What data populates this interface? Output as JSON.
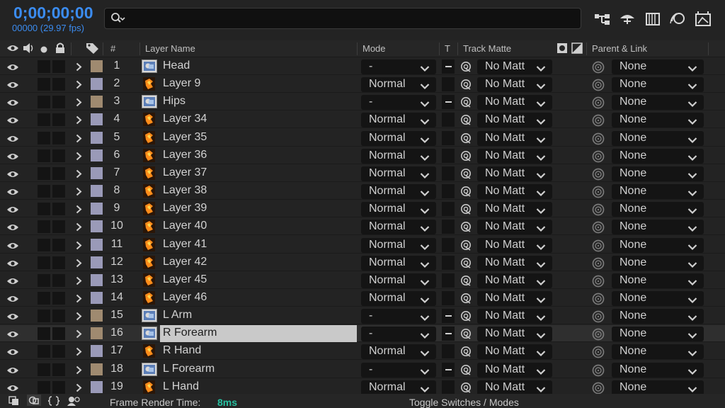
{
  "timecode": {
    "main": "0;00;00;00",
    "sub": "00000 (29.97 fps)"
  },
  "search": {
    "placeholder": ""
  },
  "toolbar_icons": [
    "comp-flowchart-icon",
    "draft-3d-icon",
    "frame-blending-icon",
    "motion-blur-icon",
    "graph-editor-icon"
  ],
  "columns": {
    "number": "#",
    "layer_name": "Layer Name",
    "mode": "Mode",
    "t": "T",
    "track_matte": "Track Matte",
    "parent": "Parent & Link"
  },
  "label_colors": {
    "tan": "#9f8a70",
    "lavender": "#9a9ab8"
  },
  "layers": [
    {
      "num": "1",
      "name": "Head",
      "type": "precomp",
      "label": "tan",
      "mode": "-",
      "t": true,
      "matte": "No Matt",
      "parent": "None"
    },
    {
      "num": "2",
      "name": "Layer 9",
      "type": "ai",
      "label": "lavender",
      "mode": "Normal",
      "t": false,
      "matte": "No Matt",
      "parent": "None"
    },
    {
      "num": "3",
      "name": "Hips",
      "type": "precomp",
      "label": "tan",
      "mode": "-",
      "t": true,
      "matte": "No Matt",
      "parent": "None"
    },
    {
      "num": "4",
      "name": "Layer 34",
      "type": "ai",
      "label": "lavender",
      "mode": "Normal",
      "t": false,
      "matte": "No Matt",
      "parent": "None"
    },
    {
      "num": "5",
      "name": "Layer 35",
      "type": "ai",
      "label": "lavender",
      "mode": "Normal",
      "t": false,
      "matte": "No Matt",
      "parent": "None"
    },
    {
      "num": "6",
      "name": "Layer 36",
      "type": "ai",
      "label": "lavender",
      "mode": "Normal",
      "t": false,
      "matte": "No Matt",
      "parent": "None"
    },
    {
      "num": "7",
      "name": "Layer 37",
      "type": "ai",
      "label": "lavender",
      "mode": "Normal",
      "t": false,
      "matte": "No Matt",
      "parent": "None"
    },
    {
      "num": "8",
      "name": "Layer 38",
      "type": "ai",
      "label": "lavender",
      "mode": "Normal",
      "t": false,
      "matte": "No Matt",
      "parent": "None"
    },
    {
      "num": "9",
      "name": "Layer 39",
      "type": "ai",
      "label": "lavender",
      "mode": "Normal",
      "t": false,
      "matte": "No Matt",
      "parent": "None"
    },
    {
      "num": "10",
      "name": "Layer 40",
      "type": "ai",
      "label": "lavender",
      "mode": "Normal",
      "t": false,
      "matte": "No Matt",
      "parent": "None"
    },
    {
      "num": "11",
      "name": "Layer 41",
      "type": "ai",
      "label": "lavender",
      "mode": "Normal",
      "t": false,
      "matte": "No Matt",
      "parent": "None"
    },
    {
      "num": "12",
      "name": "Layer 42",
      "type": "ai",
      "label": "lavender",
      "mode": "Normal",
      "t": false,
      "matte": "No Matt",
      "parent": "None"
    },
    {
      "num": "13",
      "name": "Layer 45",
      "type": "ai",
      "label": "lavender",
      "mode": "Normal",
      "t": false,
      "matte": "No Matt",
      "parent": "None"
    },
    {
      "num": "14",
      "name": "Layer 46",
      "type": "ai",
      "label": "lavender",
      "mode": "Normal",
      "t": false,
      "matte": "No Matt",
      "parent": "None"
    },
    {
      "num": "15",
      "name": "L Arm",
      "type": "precomp",
      "label": "tan",
      "mode": "-",
      "t": true,
      "matte": "No Matt",
      "parent": "None"
    },
    {
      "num": "16",
      "name": "R Forearm",
      "type": "precomp",
      "label": "tan",
      "mode": "-",
      "t": true,
      "matte": "No Matt",
      "parent": "None",
      "selected": true
    },
    {
      "num": "17",
      "name": "R Hand",
      "type": "ai",
      "label": "lavender",
      "mode": "Normal",
      "t": false,
      "matte": "No Matt",
      "parent": "None"
    },
    {
      "num": "18",
      "name": "L Forearm",
      "type": "precomp",
      "label": "tan",
      "mode": "-",
      "t": true,
      "matte": "No Matt",
      "parent": "None"
    },
    {
      "num": "19",
      "name": "L Hand",
      "type": "ai",
      "label": "lavender",
      "mode": "Normal",
      "t": false,
      "matte": "No Matt",
      "parent": "None"
    }
  ],
  "footer": {
    "frame_render_label": "Frame Render Time:",
    "frame_render_value": "8ms",
    "toggle_label": "Toggle Switches / Modes"
  }
}
